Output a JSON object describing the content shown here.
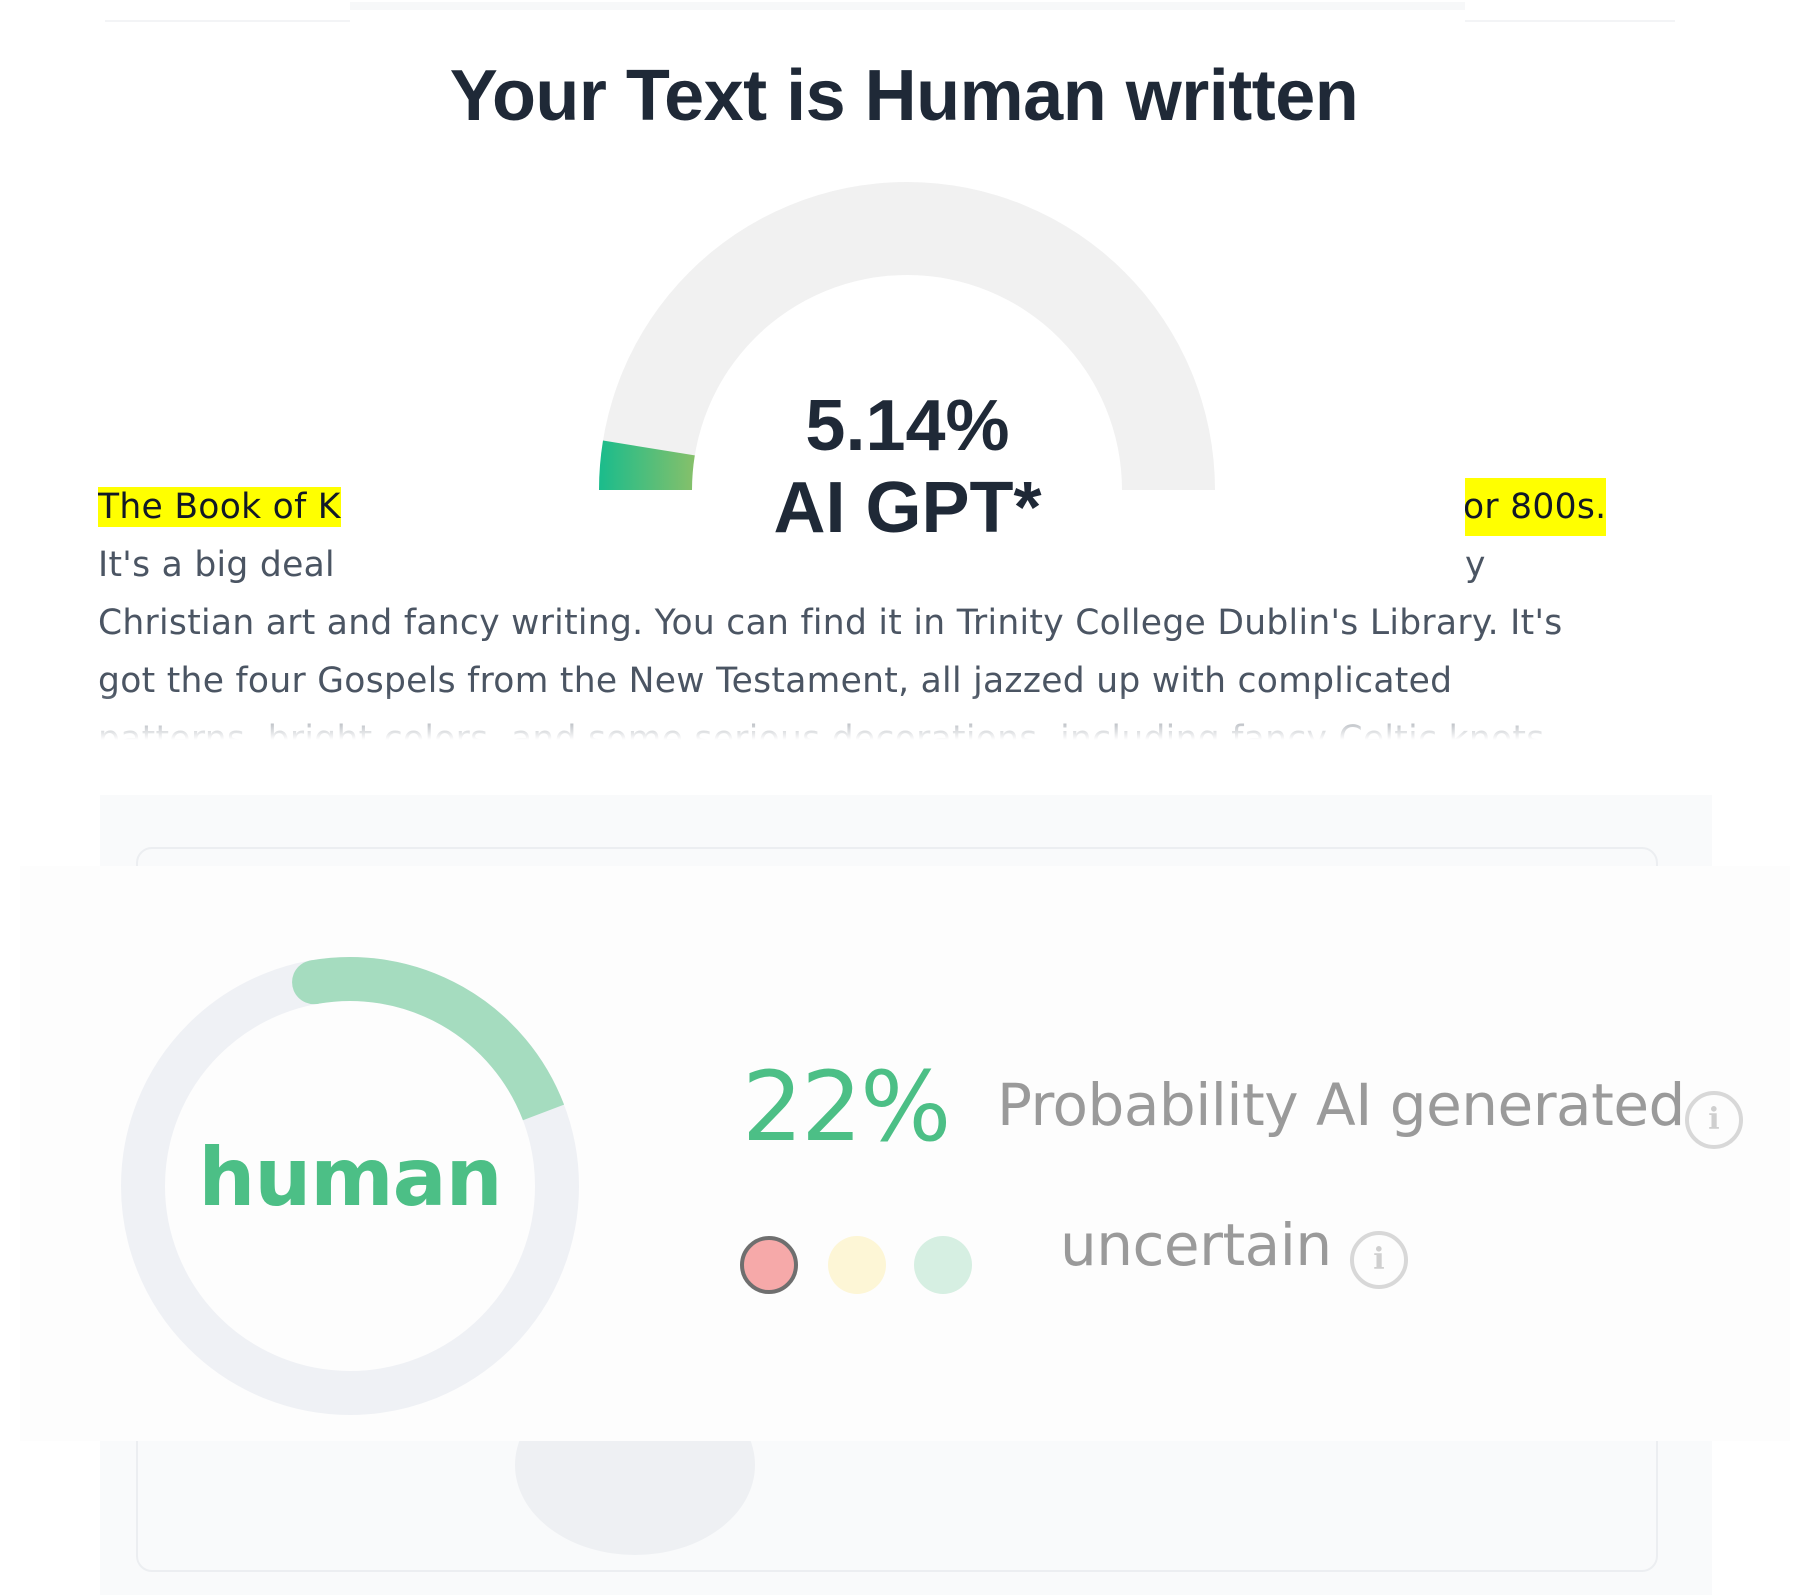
{
  "detector": {
    "title": "Your Text is Human written",
    "score": "5.14%",
    "score_value_percent": 5.14,
    "score_label": "AI GPT*",
    "gauge_track_color": "#f1f1f1",
    "gauge_fill_colors": [
      "#1abc8c",
      "#86c06a"
    ]
  },
  "sample_text": {
    "line1_start": "The Book of K",
    "line1_end": "or 800s.",
    "line2_start": "It's a big deal",
    "line2_end": "y",
    "line3": "Christian art and fancy writing. You can find it in Trinity College Dublin's Library. It's",
    "line4": "got the four Gospels from the New Testament, all jazzed up with complicated",
    "line5": "patterns, bright colors, and some serious decorations, including fancy Celtic knots"
  },
  "summary": {
    "verdict": "human",
    "probability": "22%",
    "probability_value_percent": 22,
    "probability_label": "Probability AI generated",
    "certainty_label": "uncertain",
    "info_icon": "info-icon",
    "ring_track_color": "#eff1f5",
    "ring_fill_color": "#a5dcbf",
    "accent_color": "#4cbf86",
    "certainty_levels": [
      {
        "name": "red-dot",
        "color": "#f6a9a9",
        "selected": true
      },
      {
        "name": "yellow-dot",
        "color": "#fdf6d6",
        "selected": false
      },
      {
        "name": "green-dot",
        "color": "#d6efe2",
        "selected": false
      }
    ]
  }
}
